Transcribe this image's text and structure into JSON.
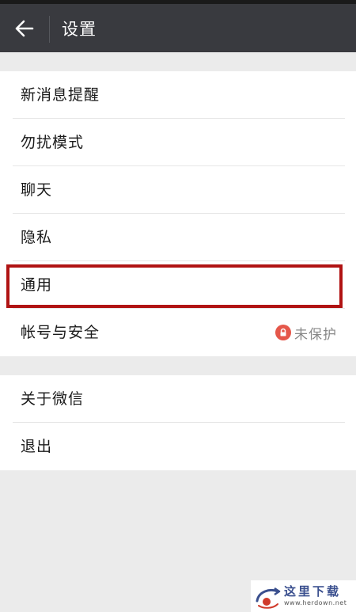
{
  "header": {
    "title": "设置"
  },
  "menu_group_1": [
    {
      "label": "新消息提醒"
    },
    {
      "label": "勿扰模式"
    },
    {
      "label": "聊天"
    },
    {
      "label": "隐私"
    },
    {
      "label": "通用"
    },
    {
      "label": "帐号与安全",
      "status": "未保护"
    }
  ],
  "menu_group_2": [
    {
      "label": "关于微信"
    },
    {
      "label": "退出"
    }
  ],
  "watermark": {
    "name": "这里下载",
    "url": "www.herdown.net"
  },
  "colors": {
    "header_bg": "#393a3f",
    "highlight_border": "#b01313",
    "lock_badge": "#e5574a",
    "page_bg": "#ebebeb"
  }
}
